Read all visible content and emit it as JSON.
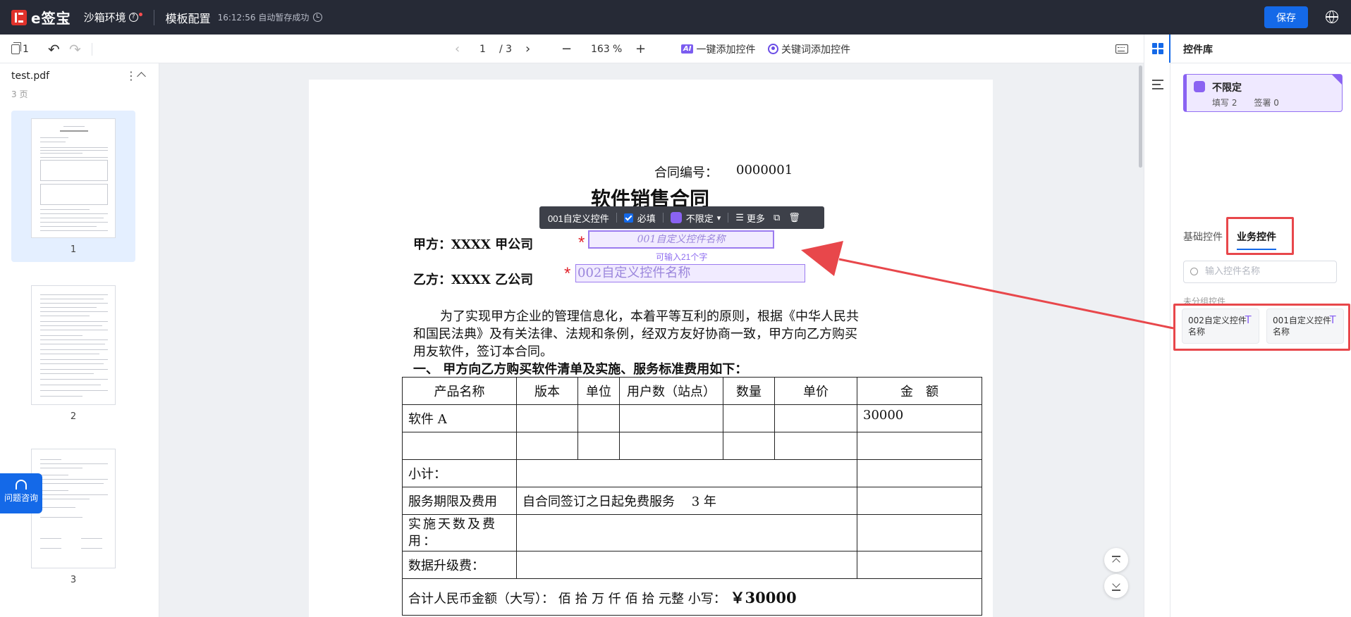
{
  "header": {
    "logo": "e签宝",
    "env": "沙箱环境",
    "template_title": "模板配置",
    "saved_status": "16:12:56 自动暂存成功",
    "save_label": "保存"
  },
  "toolbar": {
    "page_count_icon_label": "1",
    "current_page": "1",
    "total_pages": "/ 3",
    "zoom": "163",
    "zoom_unit": "%",
    "ai_badge": "AI",
    "add_all_label": "一键添加控件",
    "keyword_add_label": "关键词添加控件"
  },
  "sidebar": {
    "file_name": "test.pdf",
    "page_count": "3 页",
    "thumbnails": [
      "1",
      "2",
      "3"
    ],
    "help_label": "问题咨询"
  },
  "document": {
    "contract_no_label": "合同编号：",
    "contract_no": "0000001",
    "title": "软件销售合同",
    "party_a": "甲方：XXXX 甲公司",
    "party_b": "乙方：XXXX 乙公司",
    "field1_text": "001自定义控件名称",
    "field1_hint": "可输入21个字",
    "field2_text": "002自定义控件名称",
    "para": [
      "为了实现甲方企业的管理信息化，本着平等互利的原则，根据《中华人民共",
      "和国民法典》及有关法律、法规和条例，经双方友好协商一致，甲方向乙方购买",
      "用友软件，签订本合同。"
    ],
    "section1": "一、  甲方向乙方购买软件清单及实施、服务标准费用如下：",
    "table_headers": [
      "产品名称",
      "版本",
      "单位",
      "用户数（站点）",
      "数量",
      "单价",
      "金　额"
    ],
    "row_software": "软件 A",
    "row_software_amount": "30000",
    "subtotal": "小计：",
    "service_label": "服务期限及费用",
    "service_value": "自合同签订之日起免费服务　 3 年",
    "impl_days": "实施天数及费用：",
    "upgrade_fee": "数据升级费：",
    "total_cn": "合计人民币金额（大写）：  佰   拾   万   仟     佰   拾   元整   小写：",
    "total_num": "￥30000"
  },
  "floatbar": {
    "control_name": "001自定义控件",
    "required_label": "必填",
    "signer_label": "不限定",
    "more_label": "更多"
  },
  "right_panel": {
    "title": "控件库",
    "signer_name": "不限定",
    "signer_stats": "填写 2　　签署 0",
    "tab_basic": "基础控件",
    "tab_business": "业务控件",
    "search_placeholder": "输入控件名称",
    "group_label": "未分组控件",
    "controls": [
      "002自定义控件名称",
      "001自定义控件名称"
    ]
  },
  "colors": {
    "accent": "#1469e8",
    "signer_purple": "#8a63f2",
    "annotation_red": "#e8474b",
    "topbar": "#262a36"
  }
}
